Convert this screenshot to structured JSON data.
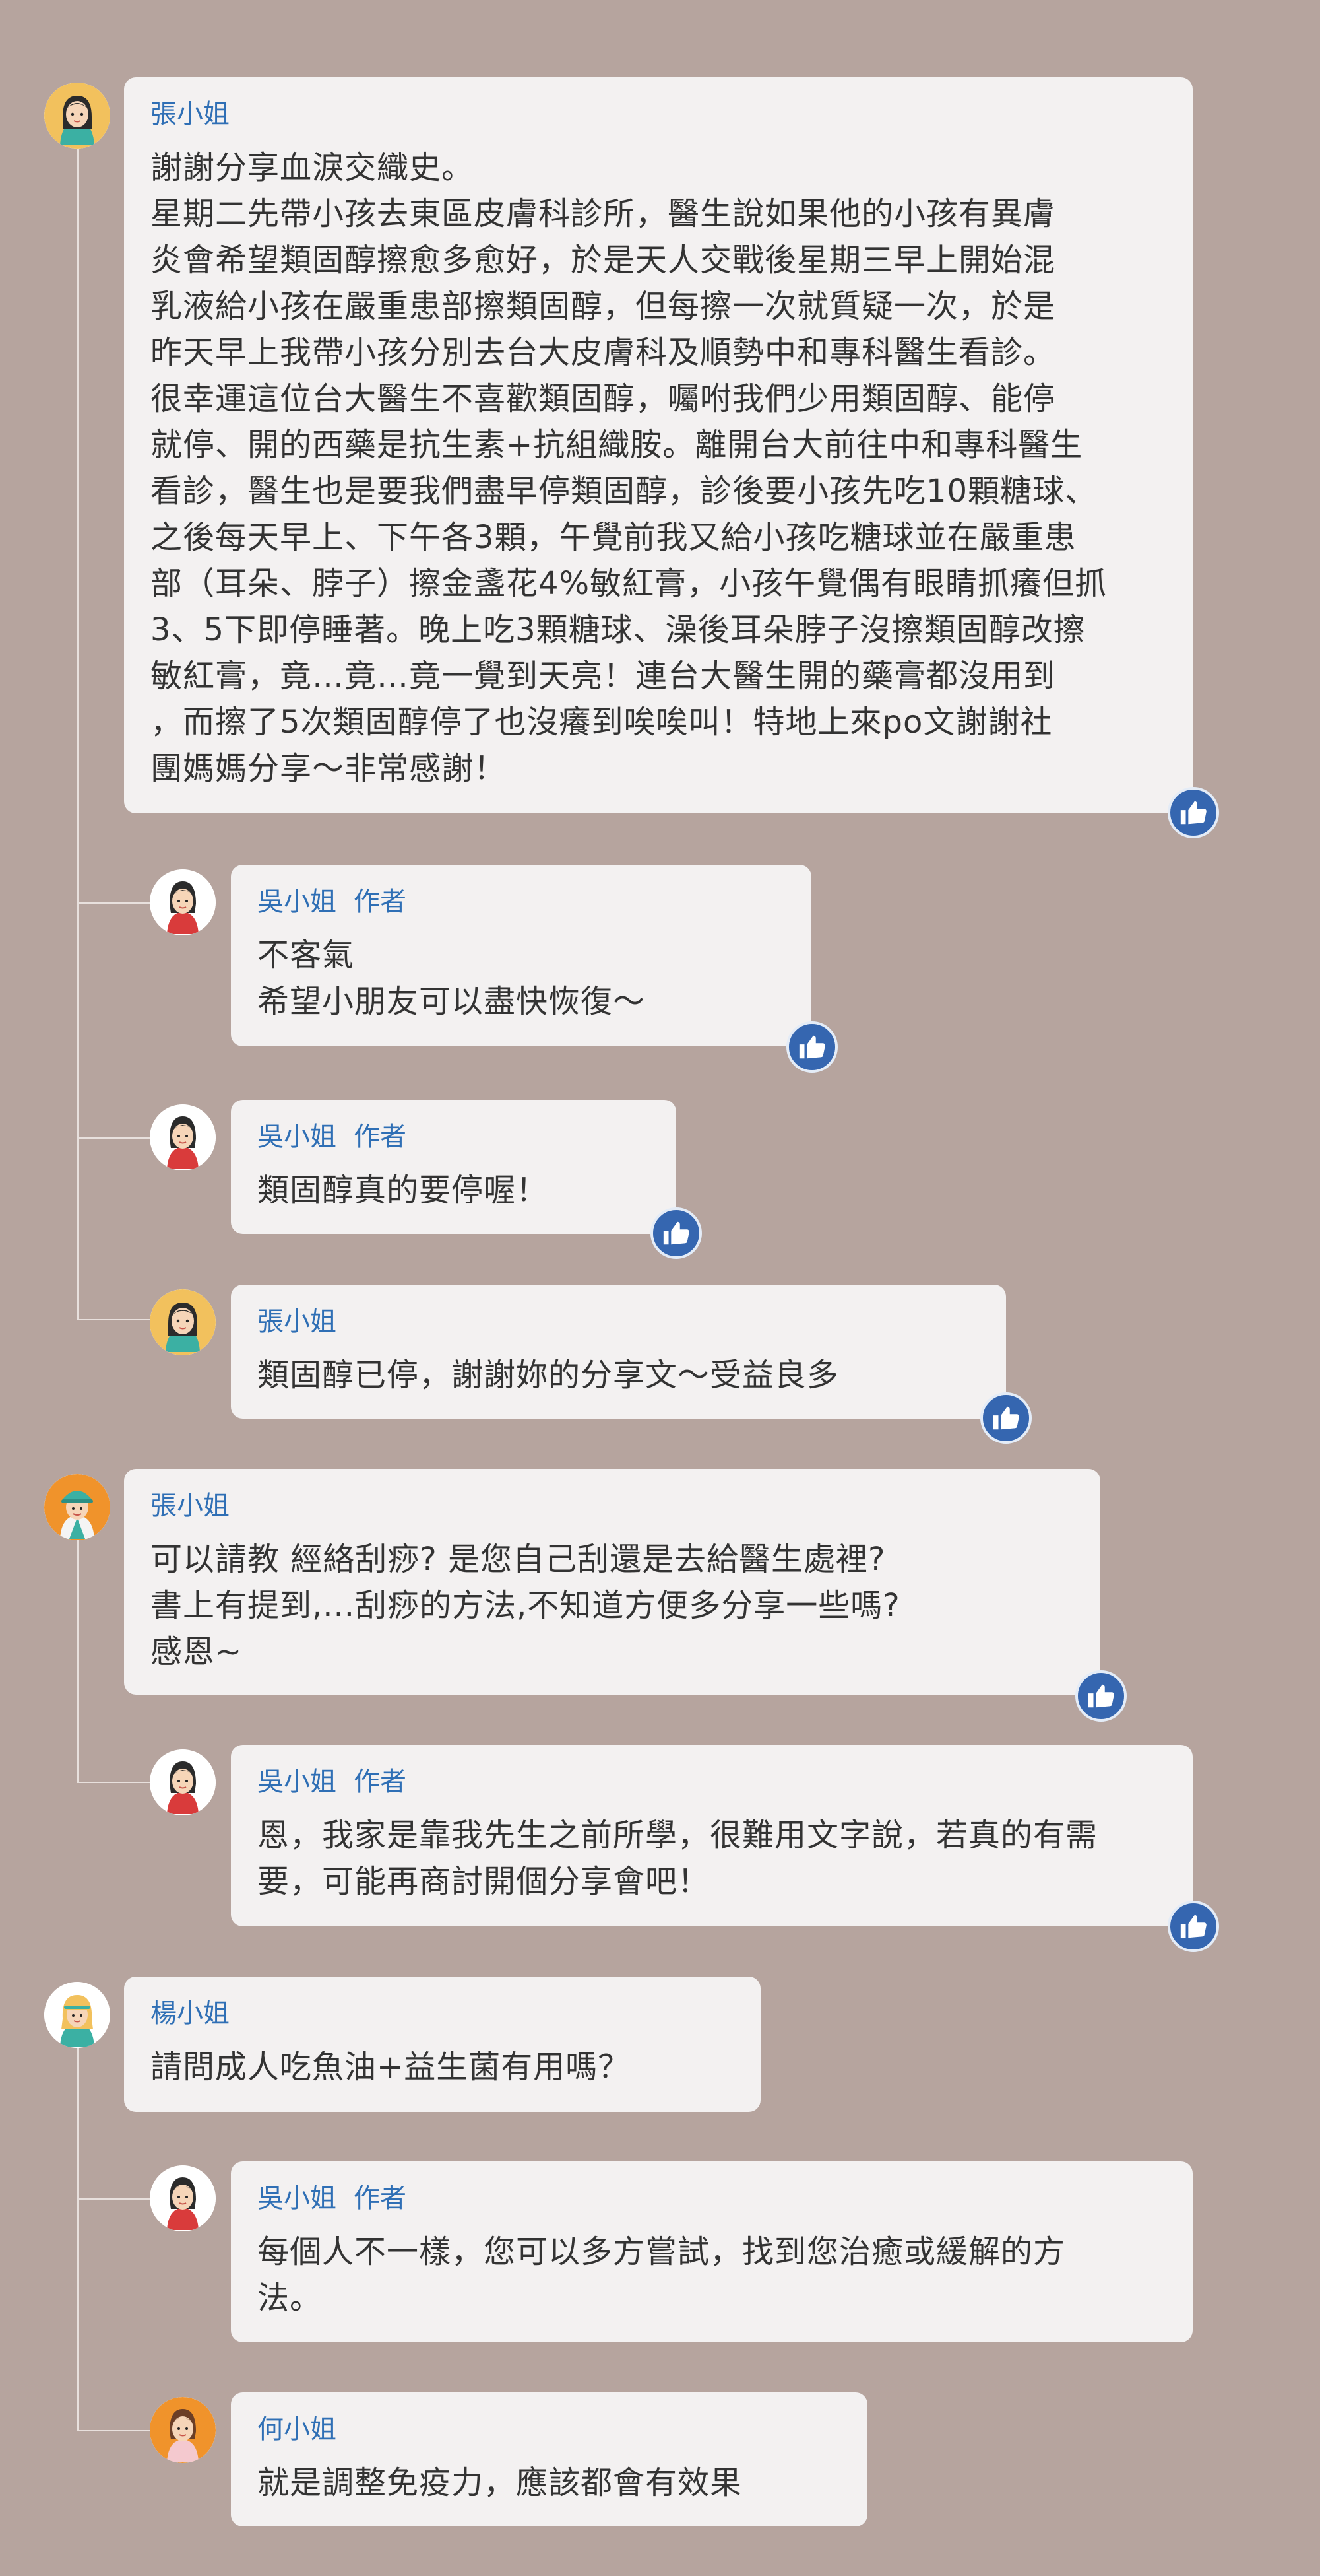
{
  "threads": [
    {
      "comment": {
        "name": "張小姐",
        "text": "謝謝分享血淚交織史。\n星期二先帶小孩去東區皮膚科診所，醫生說如果他的小孩有異膚\n炎會希望類固醇擦愈多愈好，於是天人交戰後星期三早上開始混\n乳液給小孩在嚴重患部擦類固醇，但每擦一次就質疑一次，於是\n昨天早上我帶小孩分別去台大皮膚科及順勢中和專科醫生看診。\n很幸運這位台大醫生不喜歡類固醇，囑咐我們少用類固醇、能停\n就停、開的西藥是抗生素+抗組織胺。離開台大前往中和專科醫生\n看診，醫生也是要我們盡早停類固醇，診後要小孩先吃10顆糖球、\n之後每天早上、下午各3顆，午覺前我又給小孩吃糖球並在嚴重患\n部（耳朵、脖子）擦金盞花4%敏紅膏，小孩午覺偶有眼睛抓癢但抓\n3、5下即停睡著。晚上吃3顆糖球、澡後耳朵脖子沒擦類固醇改擦\n敏紅膏，竟…竟…竟一覺到天亮！連台大醫生開的藥膏都沒用到\n，而擦了5次類固醇停了也沒癢到唉唉叫！特地上來po文謝謝社\n團媽媽分享～非常感謝！"
      },
      "replies": [
        {
          "name": "吳小姐",
          "badge": "作者",
          "text": "不客氣\n希望小朋友可以盡快恢復～"
        },
        {
          "name": "吳小姐",
          "badge": "作者",
          "text": "類固醇真的要停喔！"
        },
        {
          "name": "張小姐",
          "badge": "",
          "text": "類固醇已停，謝謝妳的分享文～受益良多"
        }
      ]
    },
    {
      "comment": {
        "name": "張小姐",
        "text": "可以請教 經絡刮痧? 是您自己刮還是去給醫生處裡?\n書上有提到,...刮痧的方法,不知道方便多分享一些嗎?\n感恩~"
      },
      "replies": [
        {
          "name": "吳小姐",
          "badge": "作者",
          "text": "恩，我家是靠我先生之前所學，很難用文字說，若真的有需\n要，可能再商討開個分享會吧！"
        }
      ]
    },
    {
      "comment": {
        "name": "楊小姐",
        "text": "請問成人吃魚油+益生菌有用嗎？"
      },
      "replies": [
        {
          "name": "吳小姐",
          "badge": "作者",
          "text": "每個人不一樣，您可以多方嘗試，找到您治癒或緩解的方\n法。"
        },
        {
          "name": "何小姐",
          "badge": "",
          "text": "就是調整免疫力，應該都會有效果"
        }
      ]
    }
  ],
  "icons": {
    "like": "thumbs-up-icon",
    "avatar": "user-avatar-icon"
  },
  "colors": {
    "background": "#b6a49e",
    "bubble": "#f3f1f1",
    "name": "#2f6fb5",
    "like": "#3566b0"
  }
}
